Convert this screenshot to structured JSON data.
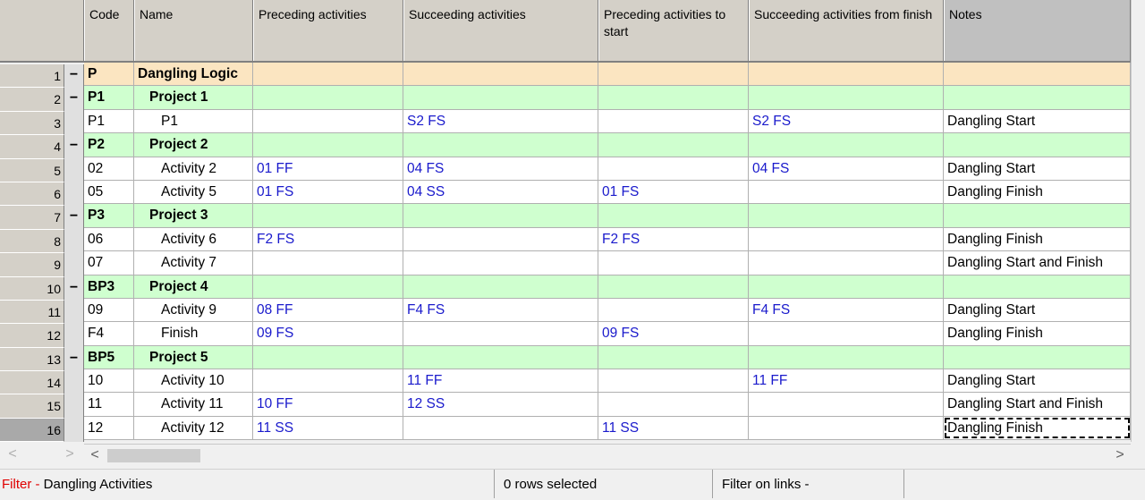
{
  "columns": {
    "code": "Code",
    "name": "Name",
    "preceding": "Preceding activities",
    "succeeding": "Succeeding activities",
    "preceding_to_start": "Preceding activities to start",
    "succeeding_from_finish": "Succeeding activities from finish",
    "notes": "Notes"
  },
  "rows": [
    {
      "num": "1",
      "collapse": "−",
      "type": "level0",
      "code": "P",
      "name": "Dangling Logic",
      "pre": "",
      "suc": "",
      "pts": "",
      "sff": "",
      "notes": ""
    },
    {
      "num": "2",
      "collapse": "−",
      "type": "level1",
      "code": "P1",
      "name": "Project 1",
      "pre": "",
      "suc": "",
      "pts": "",
      "sff": "",
      "notes": ""
    },
    {
      "num": "3",
      "collapse": "",
      "type": "act",
      "code": "P1",
      "name": "P1",
      "pre": "",
      "suc": "S2 FS",
      "pts": "",
      "sff": "S2 FS",
      "notes": "Dangling Start"
    },
    {
      "num": "4",
      "collapse": "−",
      "type": "level1",
      "code": "P2",
      "name": "Project 2",
      "pre": "",
      "suc": "",
      "pts": "",
      "sff": "",
      "notes": ""
    },
    {
      "num": "5",
      "collapse": "",
      "type": "act",
      "code": "02",
      "name": "Activity 2",
      "pre": "01 FF",
      "suc": "04 FS",
      "pts": "",
      "sff": "04 FS",
      "notes": "Dangling Start"
    },
    {
      "num": "6",
      "collapse": "",
      "type": "act",
      "code": "05",
      "name": "Activity 5",
      "pre": "01 FS",
      "suc": "04 SS",
      "pts": "01 FS",
      "sff": "",
      "notes": "Dangling Finish"
    },
    {
      "num": "7",
      "collapse": "−",
      "type": "level1",
      "code": "P3",
      "name": "Project 3",
      "pre": "",
      "suc": "",
      "pts": "",
      "sff": "",
      "notes": ""
    },
    {
      "num": "8",
      "collapse": "",
      "type": "act",
      "code": "06",
      "name": "Activity 6",
      "pre": "F2 FS",
      "suc": "",
      "pts": "F2 FS",
      "sff": "",
      "notes": "Dangling Finish"
    },
    {
      "num": "9",
      "collapse": "",
      "type": "act",
      "code": "07",
      "name": "Activity 7",
      "pre": "",
      "suc": "",
      "pts": "",
      "sff": "",
      "notes": "Dangling Start and Finish"
    },
    {
      "num": "10",
      "collapse": "−",
      "type": "level1",
      "code": "BP3",
      "name": "Project 4",
      "pre": "",
      "suc": "",
      "pts": "",
      "sff": "",
      "notes": ""
    },
    {
      "num": "11",
      "collapse": "",
      "type": "act",
      "code": "09",
      "name": "Activity 9",
      "pre": "08 FF",
      "suc": "F4 FS",
      "pts": "",
      "sff": "F4 FS",
      "notes": "Dangling Start"
    },
    {
      "num": "12",
      "collapse": "",
      "type": "act",
      "code": "F4",
      "name": "Finish",
      "pre": "09 FS",
      "suc": "",
      "pts": "09 FS",
      "sff": "",
      "notes": "Dangling Finish"
    },
    {
      "num": "13",
      "collapse": "−",
      "type": "level1",
      "code": "BP5",
      "name": "Project 5",
      "pre": "",
      "suc": "",
      "pts": "",
      "sff": "",
      "notes": ""
    },
    {
      "num": "14",
      "collapse": "",
      "type": "act",
      "code": "10",
      "name": "Activity 10",
      "pre": "",
      "suc": "11 FF",
      "pts": "",
      "sff": "11 FF",
      "notes": "Dangling Start"
    },
    {
      "num": "15",
      "collapse": "",
      "type": "act",
      "code": "11",
      "name": "Activity 11",
      "pre": "10 FF",
      "suc": "12 SS",
      "pts": "",
      "sff": "",
      "notes": "Dangling Start and Finish"
    },
    {
      "num": "16",
      "collapse": "",
      "type": "act",
      "code": "12",
      "name": "Activity 12",
      "pre": "11 SS",
      "suc": "",
      "pts": "11 SS",
      "sff": "",
      "notes": "Dangling Finish",
      "active": true
    }
  ],
  "scrollbar": {
    "left_arrow": "<",
    "right_arrow": ">",
    "mini_left": "<",
    "mini_right": ">"
  },
  "status": {
    "filter_label": "Filter -",
    "filter_value": "Dangling Activities",
    "rows_selected": "0 rows selected",
    "filter_links": "Filter on links -"
  },
  "colors": {
    "group_top": "#fbe5c1",
    "group": "#cfffcf",
    "link": "#1a1acc",
    "filter_label": "#e00000"
  }
}
